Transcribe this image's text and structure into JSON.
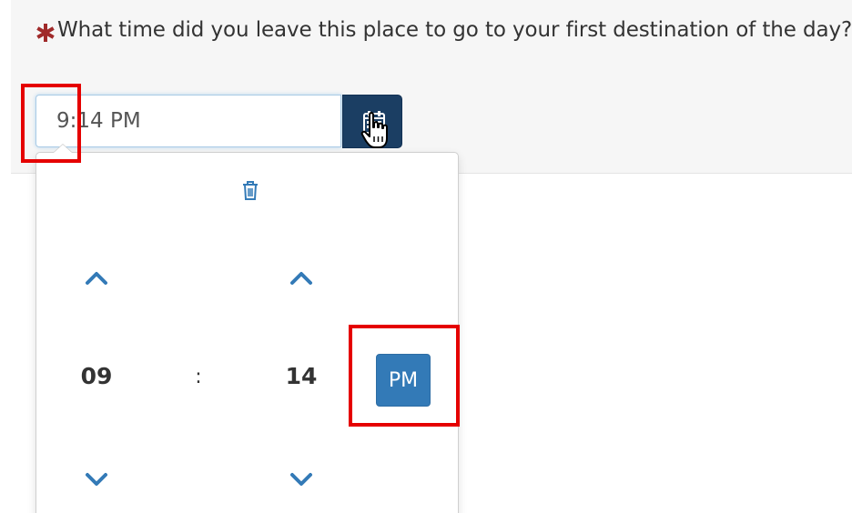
{
  "question": {
    "required_marker": "required-asterisk-icon",
    "text": "What time did you leave this place to go to your first destination of the day?"
  },
  "time_input": {
    "value": "9:14 PM"
  },
  "calendar_button": {
    "icon": "calendar-icon"
  },
  "picker": {
    "clear_icon": "trash-icon",
    "hour": "09",
    "separator": ":",
    "minute": "14",
    "period_label": "PM",
    "hour_up_icon": "chevron-up-icon",
    "hour_down_icon": "chevron-down-icon",
    "minute_up_icon": "chevron-up-icon",
    "minute_down_icon": "chevron-down-icon"
  },
  "colors": {
    "required": "#a02a2a",
    "calendar_button_bg": "#1b3e63",
    "accent_blue": "#337ab7",
    "highlight_red": "#e50000"
  }
}
